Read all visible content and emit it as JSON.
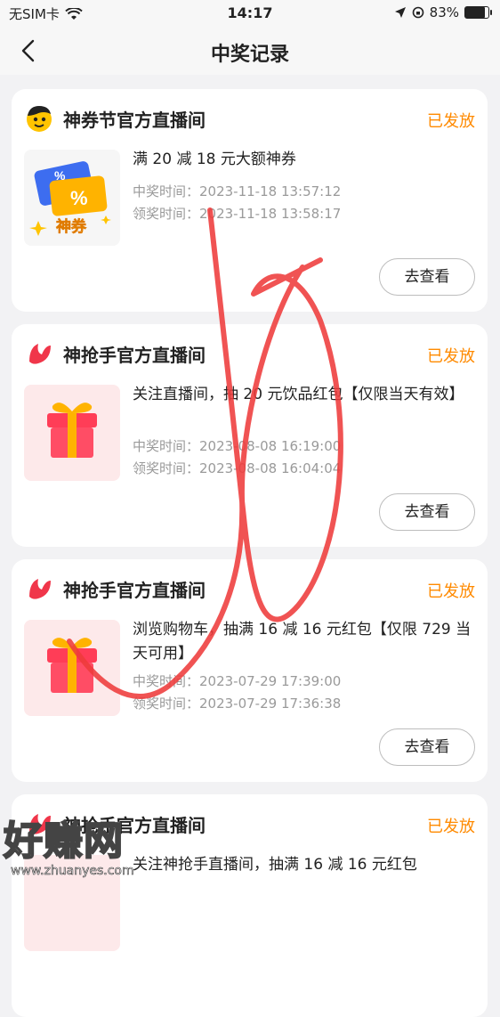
{
  "status_bar": {
    "carrier": "无SIM卡",
    "time": "14:17",
    "battery_percent": "83%",
    "battery_level": 0.83
  },
  "nav": {
    "title": "中奖记录"
  },
  "records": [
    {
      "room_name": "神券节官方直播间",
      "status": "已发放",
      "prize": "满 20 减 18 元大额神券",
      "win_time": "中奖时间：2023-11-18 13:57:12",
      "claim_time": "领奖时间：2023-11-18 13:58:17",
      "button": "去查看",
      "thumb_text": "神券"
    },
    {
      "room_name": "神抢手官方直播间",
      "status": "已发放",
      "prize": "关注直播间，抽 20 元饮品红包【仅限当天有效】",
      "win_time": "中奖时间：2023-08-08 16:19:00",
      "claim_time": "领奖时间：2023-08-08 16:04:04",
      "button": "去查看"
    },
    {
      "room_name": "神抢手官方直播间",
      "status": "已发放",
      "prize": "浏览购物车，抽满 16 减 16 元红包【仅限 729 当天可用】",
      "win_time": "中奖时间：2023-07-29 17:39:00",
      "claim_time": "领奖时间：2023-07-29 17:36:38",
      "button": "去查看"
    },
    {
      "room_name": "神抢手官方直播间",
      "status": "已发放",
      "prize": "关注神抢手直播间，抽满 16 减 16 元红包"
    }
  ],
  "watermark": {
    "text": "好赚网",
    "url": "www.zhuanyes.com"
  },
  "colors": {
    "accent": "#ff8a00",
    "scribble": "#ee3b3b",
    "background": "#f2f2f4"
  }
}
